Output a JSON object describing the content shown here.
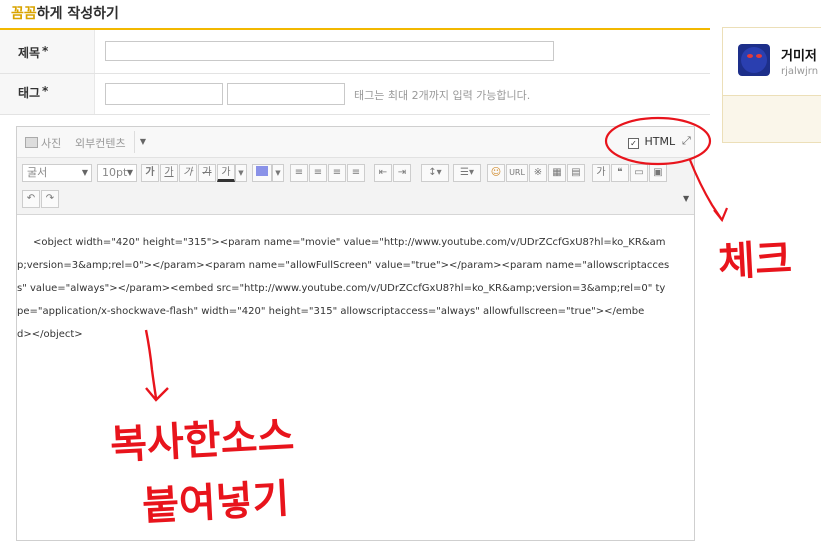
{
  "page": {
    "title_accent": "꼼꼼",
    "title_rest": "하게 작성하기"
  },
  "form": {
    "subject_label": "제목",
    "required_mark": "*",
    "tag_label": "태그",
    "tag_hint": "태그는 최대 2개까지 입력 가능합니다."
  },
  "editor": {
    "top_bar": {
      "photo": "사진",
      "external": "외부컨텐츠",
      "html_label": "HTML",
      "html_checked": true
    },
    "font_select": "굴서",
    "size_select": "10pt",
    "format_buttons": [
      "가",
      "가",
      "가",
      "가",
      "가"
    ],
    "url_button": "URL",
    "code_lines": [
      "    <object width=\"420\" height=\"315\"><param name=\"movie\" value=\"http://www.youtube.com/v/UDrZCcfGxU8?hl=ko_KR&am",
      "p;version=3&amp;rel=0\"></param><param name=\"allowFullScreen\" value=\"true\"></param><param name=\"allowscriptacces",
      "s\" value=\"always\"></param><embed src=\"http://www.youtube.com/v/UDrZCcfGxU8?hl=ko_KR&amp;version=3&amp;rel=0\" ty",
      "pe=\"application/x-shockwave-flash\" width=\"420\" height=\"315\" allowscriptaccess=\"always\" allowfullscreen=\"true\"></embe",
      "d></object>"
    ]
  },
  "sidebar": {
    "nickname": "거미저",
    "user_id": "rjalwjrn"
  },
  "annotations": {
    "check": "체크",
    "paste_line1": "복사한소스",
    "paste_line2": "붙여넣기",
    "color": "#e8141c"
  }
}
